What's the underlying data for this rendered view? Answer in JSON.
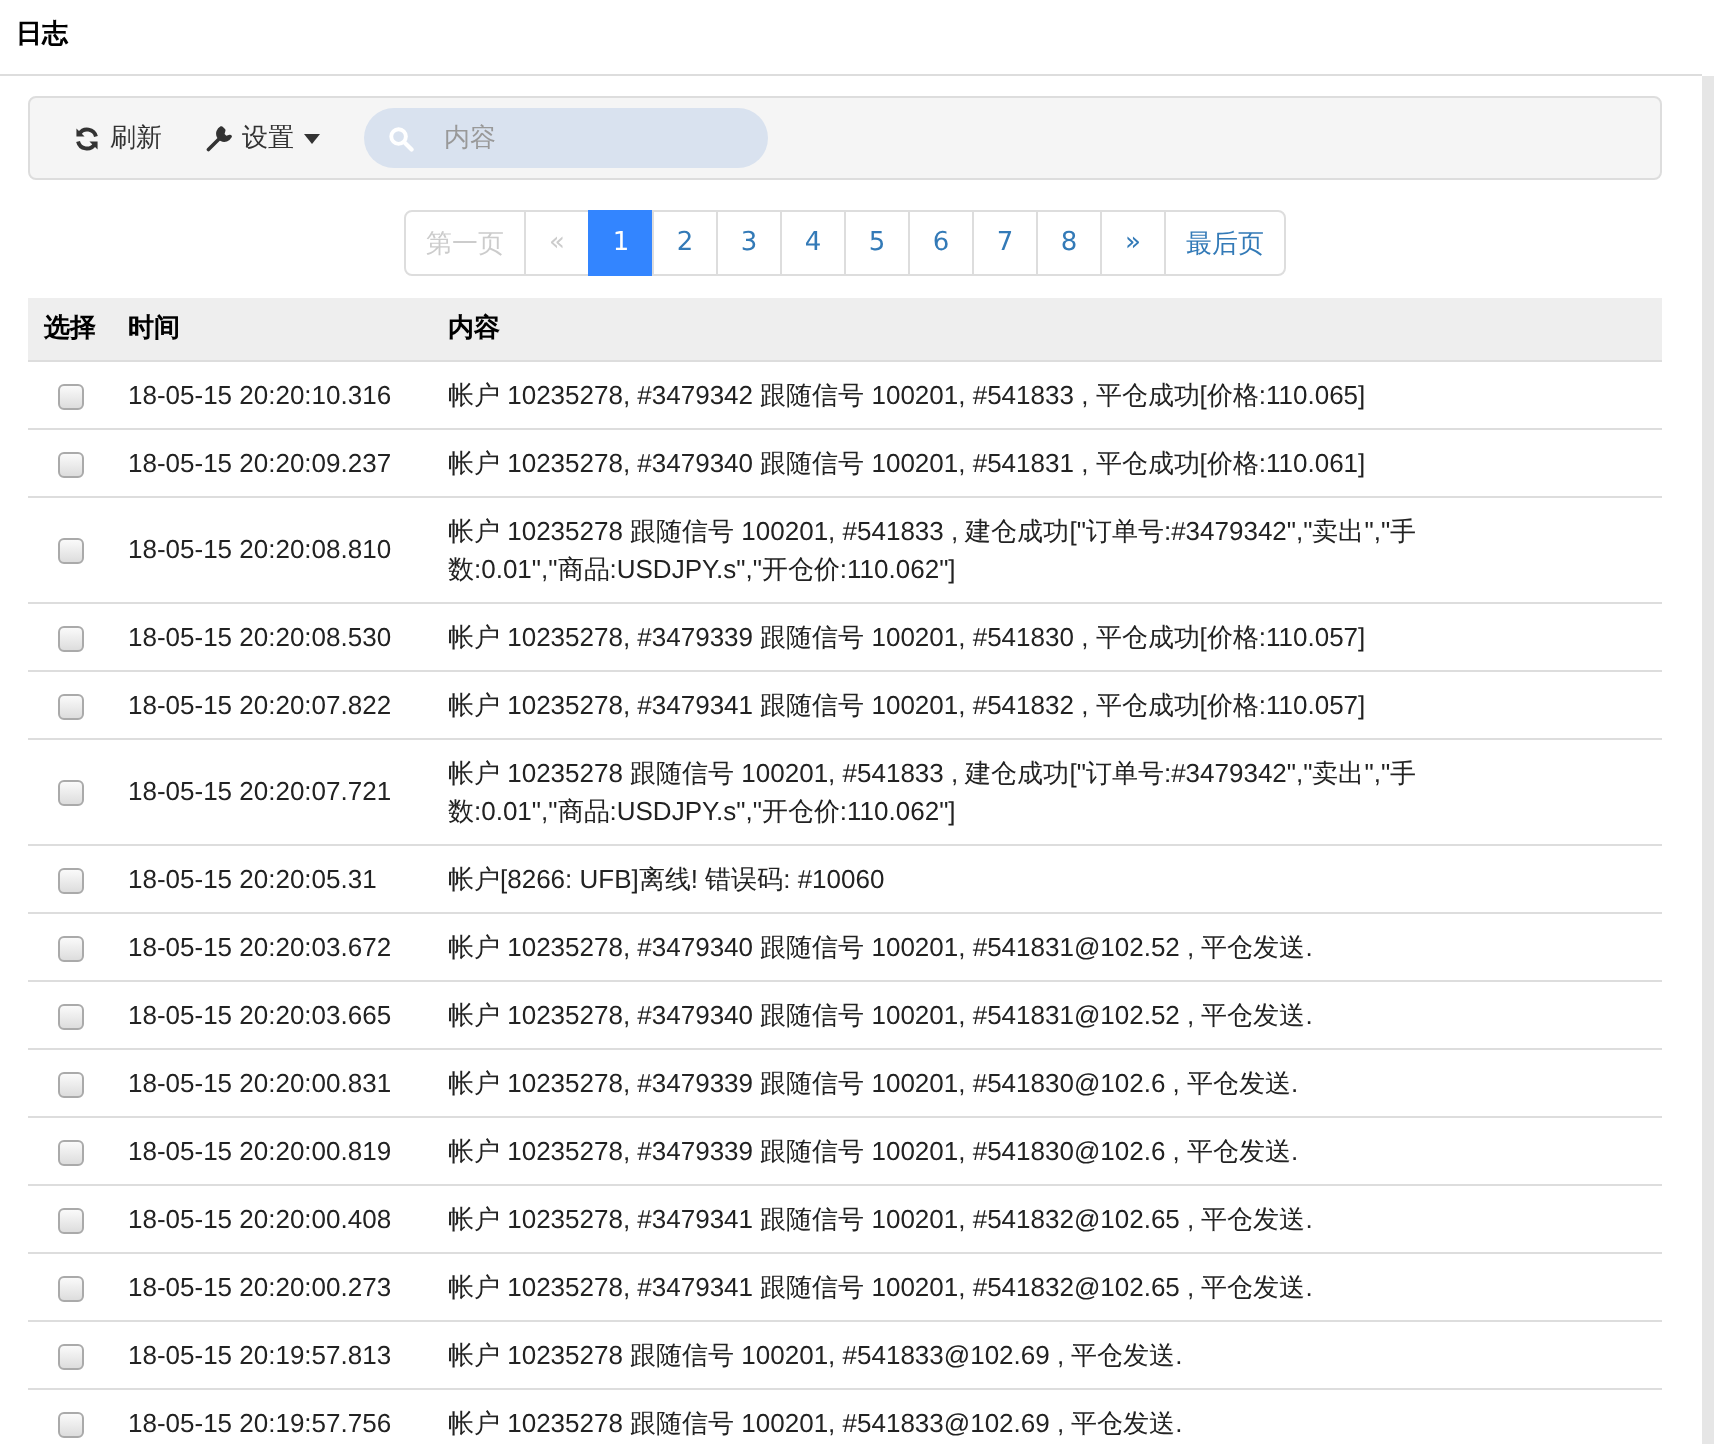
{
  "page": {
    "title": "日志"
  },
  "toolbar": {
    "refresh": "刷新",
    "settings": "设置",
    "search": {
      "placeholder": "内容"
    }
  },
  "pagination": [
    {
      "label": "第一页",
      "selected": false,
      "disabled": true
    },
    {
      "label": "«",
      "selected": false,
      "disabled": true
    },
    {
      "label": "1",
      "selected": true,
      "disabled": false
    },
    {
      "label": "2",
      "selected": false,
      "disabled": false
    },
    {
      "label": "3",
      "selected": false,
      "disabled": false
    },
    {
      "label": "4",
      "selected": false,
      "disabled": false
    },
    {
      "label": "5",
      "selected": false,
      "disabled": false
    },
    {
      "label": "6",
      "selected": false,
      "disabled": false
    },
    {
      "label": "7",
      "selected": false,
      "disabled": false
    },
    {
      "label": "8",
      "selected": false,
      "disabled": false
    },
    {
      "label": "»",
      "selected": false,
      "disabled": false
    },
    {
      "label": "最后页",
      "selected": false,
      "disabled": false
    }
  ],
  "table": {
    "columns": [
      "选择",
      "时间",
      "内容"
    ],
    "rows": [
      {
        "checked": false,
        "time": "18-05-15 20:20:10.316",
        "content": "帐户 10235278, #3479342 跟随信号 100201, #541833 , 平仓成功[价格:110.065]"
      },
      {
        "checked": false,
        "time": "18-05-15 20:20:09.237",
        "content": "帐户 10235278, #3479340 跟随信号 100201, #541831 , 平仓成功[价格:110.061]"
      },
      {
        "checked": false,
        "time": "18-05-15 20:20:08.810",
        "content": "帐户 10235278 跟随信号 100201, #541833 , 建仓成功[\"订单号:#3479342\",\"卖出\",\"手数:0.01\",\"商品:USDJPY.s\",\"开仓价:110.062\"]"
      },
      {
        "checked": false,
        "time": "18-05-15 20:20:08.530",
        "content": "帐户 10235278, #3479339 跟随信号 100201, #541830 , 平仓成功[价格:110.057]"
      },
      {
        "checked": false,
        "time": "18-05-15 20:20:07.822",
        "content": "帐户 10235278, #3479341 跟随信号 100201, #541832 , 平仓成功[价格:110.057]"
      },
      {
        "checked": false,
        "time": "18-05-15 20:20:07.721",
        "content": "帐户 10235278 跟随信号 100201, #541833 , 建仓成功[\"订单号:#3479342\",\"卖出\",\"手数:0.01\",\"商品:USDJPY.s\",\"开仓价:110.062\"]"
      },
      {
        "checked": false,
        "time": "18-05-15 20:20:05.31",
        "content": "帐户[8266: UFB]离线! 错误码: #10060"
      },
      {
        "checked": false,
        "time": "18-05-15 20:20:03.672",
        "content": "帐户 10235278, #3479340 跟随信号 100201, #541831@102.52 , 平仓发送."
      },
      {
        "checked": false,
        "time": "18-05-15 20:20:03.665",
        "content": "帐户 10235278, #3479340 跟随信号 100201, #541831@102.52 , 平仓发送."
      },
      {
        "checked": false,
        "time": "18-05-15 20:20:00.831",
        "content": "帐户 10235278, #3479339 跟随信号 100201, #541830@102.6 , 平仓发送."
      },
      {
        "checked": false,
        "time": "18-05-15 20:20:00.819",
        "content": "帐户 10235278, #3479339 跟随信号 100201, #541830@102.6 , 平仓发送."
      },
      {
        "checked": false,
        "time": "18-05-15 20:20:00.408",
        "content": "帐户 10235278, #3479341 跟随信号 100201, #541832@102.65 , 平仓发送."
      },
      {
        "checked": false,
        "time": "18-05-15 20:20:00.273",
        "content": "帐户 10235278, #3479341 跟随信号 100201, #541832@102.65 , 平仓发送."
      },
      {
        "checked": false,
        "time": "18-05-15 20:19:57.813",
        "content": "帐户 10235278 跟随信号 100201, #541833@102.69 , 平仓发送."
      },
      {
        "checked": false,
        "time": "18-05-15 20:19:57.756",
        "content": "帐户 10235278 跟随信号 100201, #541833@102.69 , 平仓发送."
      }
    ]
  }
}
